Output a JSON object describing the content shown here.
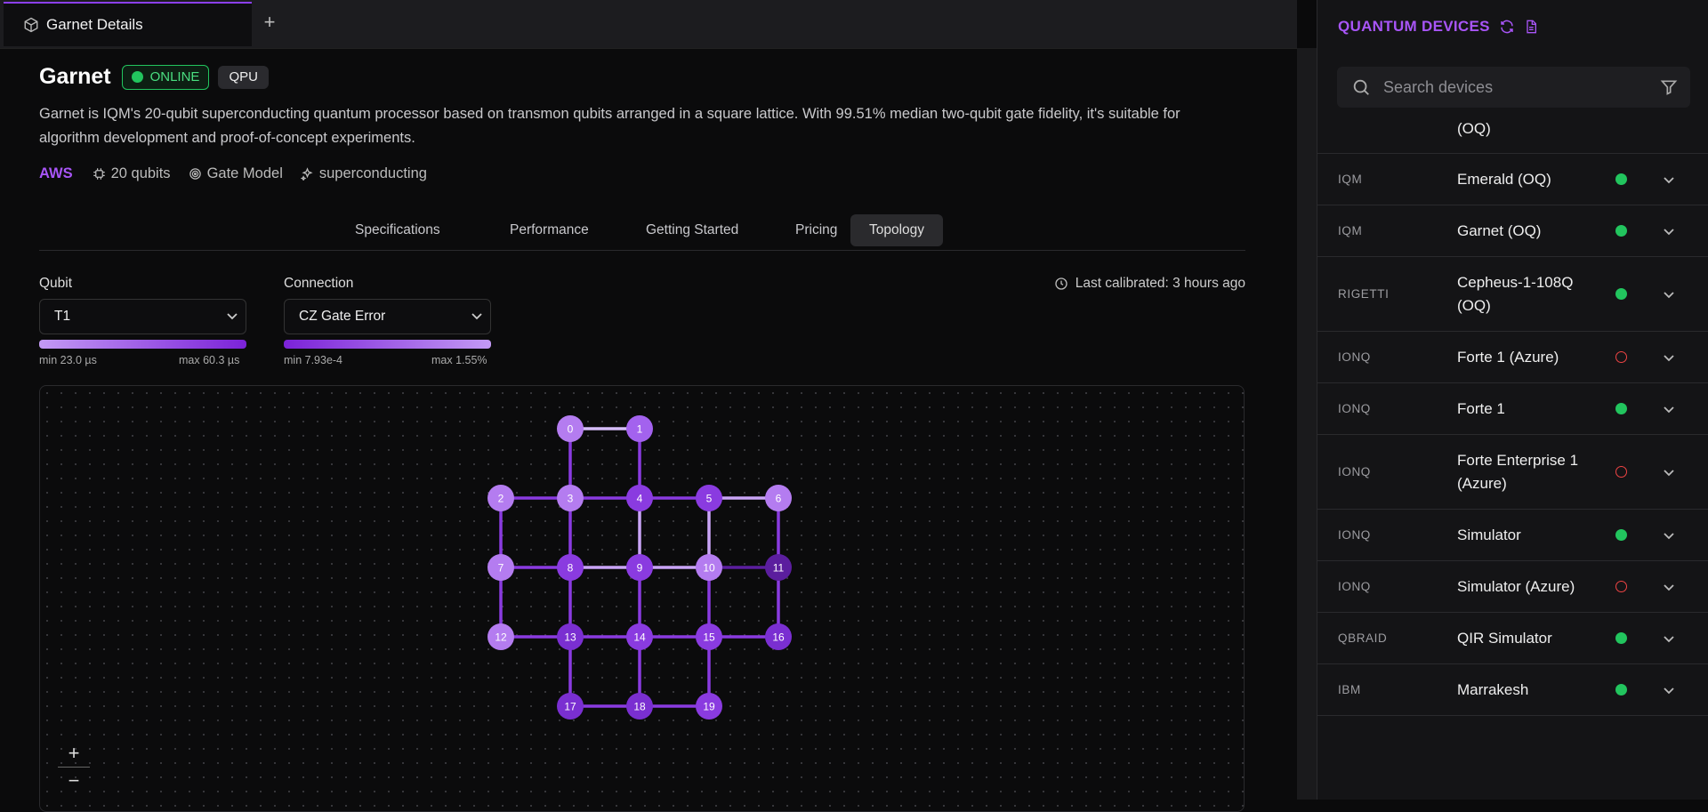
{
  "tab": {
    "label": "Garnet Details",
    "add_label": "+"
  },
  "device": {
    "name": "Garnet",
    "status": "ONLINE",
    "type": "QPU",
    "description": "Garnet is IQM's 20-qubit superconducting quantum processor based on transmon qubits arranged in a square lattice. With 99.51% median two-qubit gate fidelity, it's suitable for algorithm development and proof-of-concept experiments.",
    "provider": "AWS",
    "qubits": "20 qubits",
    "model": "Gate Model",
    "tech": "superconducting"
  },
  "detail_tabs": [
    "Specifications",
    "Performance",
    "Getting Started",
    "Pricing",
    "Topology"
  ],
  "active_tab": "Topology",
  "qubit_select": {
    "label": "Qubit",
    "value": "T1",
    "min": "min 23.0 µs",
    "max": "max 60.3 µs"
  },
  "connection_select": {
    "label": "Connection",
    "value": "CZ Gate Error",
    "min": "min 7.93e-4",
    "max": "max 1.55%"
  },
  "calibrated": "Last calibrated: 3 hours ago",
  "zoom": {
    "in": "+",
    "out": "−"
  },
  "topology": {
    "nodes": [
      {
        "id": "0",
        "col": 1,
        "row": 0,
        "c": "#b47cf0"
      },
      {
        "id": "1",
        "col": 2,
        "row": 0,
        "c": "#a362ee"
      },
      {
        "id": "2",
        "col": 0,
        "row": 1,
        "c": "#b47cf0"
      },
      {
        "id": "3",
        "col": 1,
        "row": 1,
        "c": "#b47cf0"
      },
      {
        "id": "4",
        "col": 2,
        "row": 1,
        "c": "#8a3be0"
      },
      {
        "id": "5",
        "col": 3,
        "row": 1,
        "c": "#8a3be0"
      },
      {
        "id": "6",
        "col": 4,
        "row": 1,
        "c": "#b47cf0"
      },
      {
        "id": "7",
        "col": 0,
        "row": 2,
        "c": "#b47cf0"
      },
      {
        "id": "8",
        "col": 1,
        "row": 2,
        "c": "#8a3be0"
      },
      {
        "id": "9",
        "col": 2,
        "row": 2,
        "c": "#8a3be0"
      },
      {
        "id": "10",
        "col": 3,
        "row": 2,
        "c": "#b47cf0"
      },
      {
        "id": "11",
        "col": 4,
        "row": 2,
        "c": "#5b1e9e"
      },
      {
        "id": "12",
        "col": 0,
        "row": 3,
        "c": "#b47cf0"
      },
      {
        "id": "13",
        "col": 1,
        "row": 3,
        "c": "#7a2fd1"
      },
      {
        "id": "14",
        "col": 2,
        "row": 3,
        "c": "#8a3be0"
      },
      {
        "id": "15",
        "col": 3,
        "row": 3,
        "c": "#8a3be0"
      },
      {
        "id": "16",
        "col": 4,
        "row": 3,
        "c": "#7a2fd1"
      },
      {
        "id": "17",
        "col": 1,
        "row": 4,
        "c": "#7a2fd1"
      },
      {
        "id": "18",
        "col": 2,
        "row": 4,
        "c": "#7a2fd1"
      },
      {
        "id": "19",
        "col": 3,
        "row": 4,
        "c": "#8a3be0"
      }
    ],
    "edges": [
      [
        "0",
        "1",
        "#d6bdf8"
      ],
      [
        "0",
        "3",
        "#8a3be0"
      ],
      [
        "1",
        "4",
        "#8a3be0"
      ],
      [
        "2",
        "3",
        "#8a3be0"
      ],
      [
        "3",
        "4",
        "#8a3be0"
      ],
      [
        "4",
        "5",
        "#8a3be0"
      ],
      [
        "5",
        "6",
        "#c9a4f6"
      ],
      [
        "2",
        "7",
        "#8a3be0"
      ],
      [
        "3",
        "8",
        "#8a3be0"
      ],
      [
        "4",
        "9",
        "#c9a4f6"
      ],
      [
        "5",
        "10",
        "#c9a4f6"
      ],
      [
        "6",
        "11",
        "#8a3be0"
      ],
      [
        "7",
        "8",
        "#8a3be0"
      ],
      [
        "8",
        "9",
        "#c9a4f6"
      ],
      [
        "9",
        "10",
        "#c9a4f6"
      ],
      [
        "10",
        "11",
        "#5b1e9e"
      ],
      [
        "7",
        "12",
        "#8a3be0"
      ],
      [
        "8",
        "13",
        "#8a3be0"
      ],
      [
        "9",
        "14",
        "#8a3be0"
      ],
      [
        "10",
        "15",
        "#8a3be0"
      ],
      [
        "11",
        "16",
        "#8a3be0"
      ],
      [
        "12",
        "13",
        "#8a3be0"
      ],
      [
        "13",
        "14",
        "#8a3be0"
      ],
      [
        "14",
        "15",
        "#8a3be0"
      ],
      [
        "15",
        "16",
        "#8a3be0"
      ],
      [
        "13",
        "17",
        "#8a3be0"
      ],
      [
        "14",
        "18",
        "#8a3be0"
      ],
      [
        "15",
        "19",
        "#8a3be0"
      ],
      [
        "17",
        "18",
        "#8a3be0"
      ],
      [
        "18",
        "19",
        "#8a3be0"
      ]
    ]
  },
  "panel": {
    "title": "QUANTUM DEVICES",
    "search_placeholder": "Search devices",
    "partial_row": "(OQ)",
    "devices": [
      {
        "provider": "IQM",
        "name": "Emerald (OQ)",
        "online": true
      },
      {
        "provider": "IQM",
        "name": "Garnet (OQ)",
        "online": true
      },
      {
        "provider": "RIGETTI",
        "name": "Cepheus-1-108Q (OQ)",
        "online": true
      },
      {
        "provider": "IONQ",
        "name": "Forte 1 (Azure)",
        "online": false
      },
      {
        "provider": "IONQ",
        "name": "Forte 1",
        "online": true
      },
      {
        "provider": "IONQ",
        "name": "Forte Enterprise 1 (Azure)",
        "online": false
      },
      {
        "provider": "IONQ",
        "name": "Simulator",
        "online": true
      },
      {
        "provider": "IONQ",
        "name": "Simulator (Azure)",
        "online": false
      },
      {
        "provider": "QBRAID",
        "name": "QIR Simulator",
        "online": true
      },
      {
        "provider": "IBM",
        "name": "Marrakesh",
        "online": true
      }
    ]
  },
  "colors": {
    "accent": "#a855f7",
    "online": "#22c55e",
    "offline": "#ef4444"
  }
}
